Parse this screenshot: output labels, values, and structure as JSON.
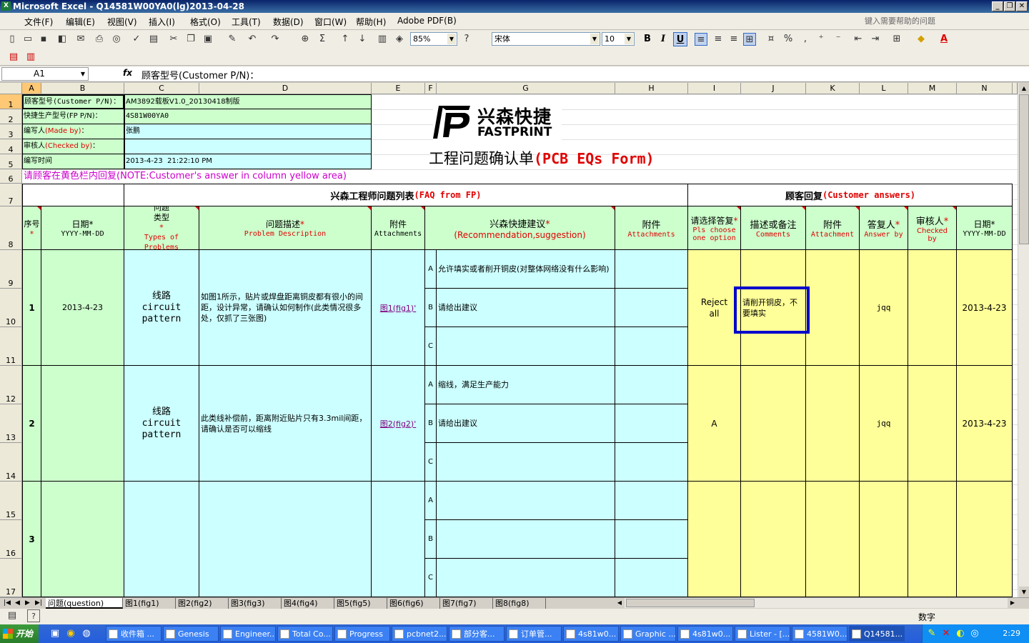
{
  "window": {
    "title": "Microsoft Excel - Q14581W00YA0(lg)2013-04-28",
    "app_icon": "excel-icon"
  },
  "menu": [
    "文件(F)",
    "编辑(E)",
    "视图(V)",
    "插入(I)",
    "格式(O)",
    "工具(T)",
    "数据(D)",
    "窗口(W)",
    "帮助(H)",
    "Adobe PDF(B)"
  ],
  "help_search": {
    "placeholder": "键入需要帮助的问题"
  },
  "toolbar": {
    "zoom": "85%",
    "font": "宋体",
    "font_size": "10",
    "bold": "B",
    "italic": "I",
    "underline": "U",
    "percent": "%",
    "comma": ",",
    "sigma": "Σ"
  },
  "formula": {
    "name_box": "A1",
    "fx": "fx",
    "content": "顾客型号(Customer P/N)："
  },
  "columns": [
    "A",
    "B",
    "C",
    "D",
    "E",
    "F",
    "G",
    "H",
    "I",
    "J",
    "K",
    "L",
    "M",
    "N"
  ],
  "rows": [
    "1",
    "2",
    "3",
    "4",
    "5",
    "6",
    "7",
    "8",
    "9",
    "10",
    "11",
    "12",
    "13",
    "14",
    "15",
    "16",
    "17"
  ],
  "info": {
    "customer_pn_label": "顾客型号(Customer P/N)：",
    "customer_pn_value": "AM3892载板V1.0_20130418制版",
    "fp_pn_label": "快捷生产型号(FP P/N)：",
    "fp_pn_value": "4S81W00YA0",
    "made_by_label_cn": "编写人",
    "made_by_label_en": "(Made by)",
    "made_by_colon": "：",
    "made_by_value": "张鹏",
    "checked_by_label_cn": "审核人",
    "checked_by_label_en": "(Checked by)",
    "checked_by_colon": "：",
    "time_label": "编写时间",
    "time_value": "2013-4-23  21:22:10 PM",
    "note_cn": "请顾客在黄色栏内回复",
    "note_en": "(NOTE:Customer's answer in column yellow area)"
  },
  "logo": {
    "cn": "兴森快捷",
    "en": "FASTPRINT"
  },
  "form_title": {
    "cn": "工程问题确认单",
    "en": "(PCB EQs Form)"
  },
  "sections": {
    "fp_cn": "兴森工程师问题列表",
    "fp_en": "(FAQ from FP)",
    "cust_cn": "顾客回复",
    "cust_en": "(Customer answers)"
  },
  "headers": {
    "seq": "序号",
    "date": "日期",
    "date_fmt": "YYYY-MM-DD",
    "type_cn": "问题类型",
    "type_en": "Types of Problems",
    "desc_cn": "问题描述",
    "desc_en": "Problem Description",
    "attach_cn": "附件",
    "attach_en": "Attachments",
    "rec_cn": "兴森快捷建议",
    "rec_en": "(Recommendation,suggestion)",
    "attach2_cn": "附件",
    "attach2_en": "Attachments",
    "choose_cn": "请选择答复",
    "choose_en": "Pls choose one option",
    "comments_cn": "描述或备注",
    "comments_en": "Comments",
    "attach3_cn": "附件",
    "attach3_en": "Attachment",
    "answer_cn": "答复人",
    "answer_en": "Answer by",
    "checked_cn": "审核人",
    "checked_en": "Checked by",
    "date2": "日期",
    "date2_fmt": "YYYY-MM-DD",
    "star": "*"
  },
  "issues": [
    {
      "seq": "1",
      "date": "2013-4-23",
      "type_cn": "线路",
      "type_en1": "circuit",
      "type_en2": "pattern",
      "desc": "如图1所示，贴片或焊盘距离铜皮都有很小的间距，设计异常，请确认如何制作(此类情况很多处，仅抓了三张图)",
      "attach": "图1(fig1)'",
      "options": [
        {
          "letter": "A",
          "text": "允许填实或者削开铜皮(对整体网络没有什么影响)"
        },
        {
          "letter": "B",
          "text": "请给出建议"
        },
        {
          "letter": "C",
          "text": ""
        }
      ],
      "choice": "Reject all",
      "comment": "请削开铜皮，不要填实",
      "answer_by": "jqq",
      "date2": "2013-4-23"
    },
    {
      "seq": "2",
      "date": "",
      "type_cn": "线路",
      "type_en1": "circuit",
      "type_en2": "pattern",
      "desc": "此类线补偿前，距离附近贴片只有3.3mil间距，请确认是否可以缩线",
      "attach": "图2(fig2)'",
      "options": [
        {
          "letter": "A",
          "text": "缩线，满足生产能力"
        },
        {
          "letter": "B",
          "text": "请给出建议"
        },
        {
          "letter": "C",
          "text": ""
        }
      ],
      "choice": "A",
      "comment": "",
      "answer_by": "jqq",
      "date2": "2013-4-23"
    },
    {
      "seq": "3",
      "date": "",
      "type_cn": "",
      "type_en1": "",
      "type_en2": "",
      "desc": "",
      "attach": "",
      "options": [
        {
          "letter": "A",
          "text": ""
        },
        {
          "letter": "B",
          "text": ""
        },
        {
          "letter": "C",
          "text": ""
        }
      ],
      "choice": "",
      "comment": "",
      "answer_by": "",
      "date2": ""
    }
  ],
  "sheet_tabs": [
    "问题(question)",
    "图1(fig1)",
    "图2(fig2)",
    "图3(fig3)",
    "图4(fig4)",
    "图5(fig5)",
    "图6(fig6)",
    "图7(fig7)",
    "图8(fig8)"
  ],
  "status": {
    "mode": "数字"
  },
  "taskbar": {
    "start": "开始",
    "clock": "2:29",
    "items": [
      "收件箱 ...",
      "Genesis",
      "Engineer...",
      "Total Co...",
      "Progress",
      "pcbnet2...",
      "部分客...",
      "订单管...",
      "4s81w0...",
      "Graphic ...",
      "4s81w0...",
      "Lister - [...",
      "4581W0...",
      "Q14581..."
    ]
  },
  "colors": {
    "highlight_box": "#0000cc",
    "customer_area": "#ffff99",
    "fp_area": "#ccffff",
    "header_green": "#ccffcc"
  }
}
